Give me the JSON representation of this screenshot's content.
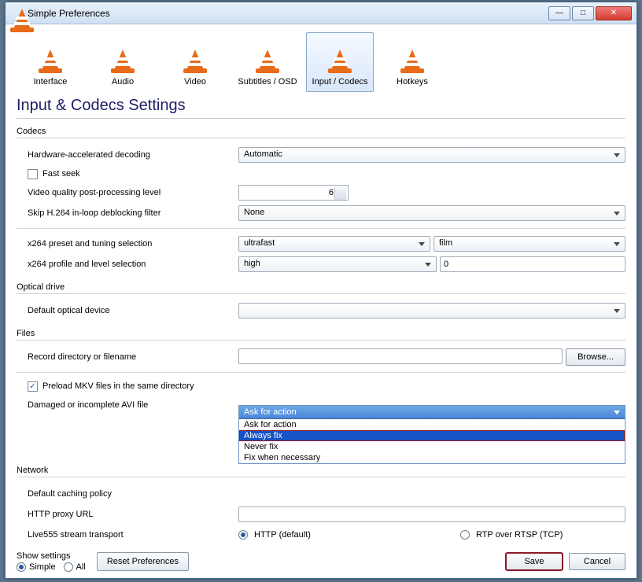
{
  "window_title": "Simple Preferences",
  "categories": [
    {
      "label": "Interface"
    },
    {
      "label": "Audio"
    },
    {
      "label": "Video"
    },
    {
      "label": "Subtitles / OSD"
    },
    {
      "label": "Input / Codecs"
    },
    {
      "label": "Hotkeys"
    }
  ],
  "page_heading": "Input & Codecs Settings",
  "groups": {
    "codecs": {
      "title": "Codecs",
      "hw_label": "Hardware-accelerated decoding",
      "hw_value": "Automatic",
      "fast_seek": "Fast seek",
      "pp_label": "Video quality post-processing level",
      "pp_value": "6",
      "skip_label": "Skip H.264 in-loop deblocking filter",
      "skip_value": "None",
      "x264_preset_label": "x264 preset and tuning selection",
      "x264_preset_value": "ultrafast",
      "x264_tune_value": "film",
      "x264_profile_label": "x264 profile and level selection",
      "x264_profile_value": "high",
      "x264_level_value": "0"
    },
    "optical": {
      "title": "Optical drive",
      "device_label": "Default optical device",
      "device_value": ""
    },
    "files": {
      "title": "Files",
      "record_label": "Record directory or filename",
      "record_value": "",
      "browse": "Browse...",
      "preload": "Preload MKV files in the same directory",
      "avi_label": "Damaged or incomplete AVI file",
      "avi_value": "Ask for action",
      "avi_options": [
        "Ask for action",
        "Always fix",
        "Never fix",
        "Fix when necessary"
      ]
    },
    "network": {
      "title": "Network",
      "caching_label": "Default caching policy",
      "proxy_label": "HTTP proxy URL",
      "proxy_value": "",
      "live555_label": "Live555 stream transport",
      "live555_http": "HTTP (default)",
      "live555_rtp": "RTP over RTSP (TCP)"
    }
  },
  "footer": {
    "show_settings": "Show settings",
    "simple": "Simple",
    "all": "All",
    "reset": "Reset Preferences",
    "save": "Save",
    "cancel": "Cancel"
  }
}
